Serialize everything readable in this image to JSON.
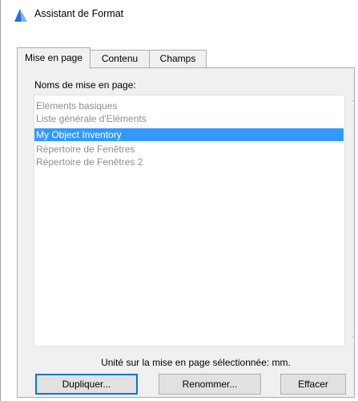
{
  "window": {
    "title": "Assistant de Format"
  },
  "tabs": [
    {
      "label": "Mise en page"
    },
    {
      "label": "Contenu"
    },
    {
      "label": "Champs"
    }
  ],
  "list": {
    "label": "Noms de mise en page:",
    "items": [
      {
        "label": "Eléments basiques"
      },
      {
        "label": "Liste générale d'Eléments"
      },
      {
        "label": "My Object Inventory"
      },
      {
        "label": "Répertoire de Fenêtres"
      },
      {
        "label": "Répertoire de Fenêtres 2"
      }
    ],
    "selected": "My Object Inventory"
  },
  "unit_text": "Unité sur la mise en page sélectionnée: mm.",
  "buttons": {
    "duplicate": "Dupliquer...",
    "rename": "Renommer...",
    "delete": "Effacer"
  },
  "colors": {
    "selection": "#3399ff",
    "default_button_border": "#0078d7",
    "panel": "#f0f0f0"
  },
  "icons": {
    "app": "archicad-icon",
    "scroll_up": "scroll-up-icon",
    "scroll_down": "scroll-down-icon"
  }
}
